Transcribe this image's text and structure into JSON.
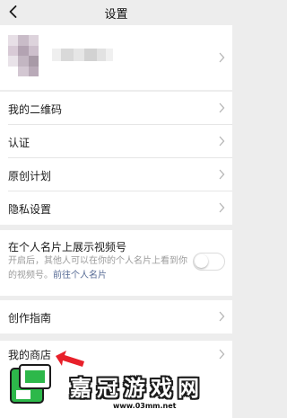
{
  "nav": {
    "title": "设置"
  },
  "profile": {
    "name_blurred": true
  },
  "rows": {
    "qrcode": "我的二维码",
    "verify": "认证",
    "original": "原创计划",
    "privacy": "隐私设置",
    "guide": "创作指南",
    "shop": "我的商店"
  },
  "video_card": {
    "title": "在个人名片上展示视频号",
    "desc": "开启后，其他人可以在你的个人名片上看到你的视频号。",
    "link": "前往个人名片",
    "enabled": false
  },
  "watermark": {
    "brand": "嘉冠游戏网",
    "url": "www.03mm.net"
  },
  "colors": {
    "bg": "#ededed",
    "card": "#ffffff",
    "link": "#576b95",
    "arrow": "#e8202a",
    "logo_green": "#2db84a"
  }
}
